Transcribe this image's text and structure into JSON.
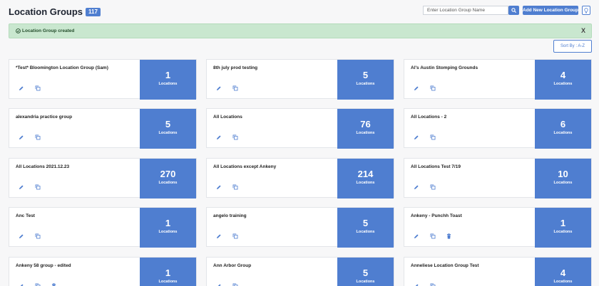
{
  "header": {
    "title": "Location Groups",
    "count_badge": "117",
    "search_placeholder": "Enter Location Group Name",
    "search_icon": "search-icon",
    "add_button_label": "Add New Location Group",
    "tips_icon": "lightbulb-icon"
  },
  "alert": {
    "icon": "check-circle-icon",
    "message": "Location Group created",
    "close_label": "X"
  },
  "sort": {
    "label": "Sort By : A-Z"
  },
  "colors": {
    "accent": "#4f7ed0",
    "alert_bg": "#c9e7cf"
  },
  "card_common": {
    "locations_label": "Locations",
    "icons": [
      "pencil-icon",
      "copy-icon",
      "trash-icon"
    ]
  },
  "cards": [
    {
      "name": "*Test* Bloomington Location Group (Sam)",
      "count": "1",
      "deletable": false
    },
    {
      "name": "8th july prod testing",
      "count": "5",
      "deletable": false
    },
    {
      "name": "Al's Austin Stomping Grounds",
      "count": "4",
      "deletable": false
    },
    {
      "name": "alexandria practice group",
      "count": "5",
      "deletable": false
    },
    {
      "name": "All Locations",
      "count": "76",
      "deletable": false
    },
    {
      "name": "All Locations - 2",
      "count": "6",
      "deletable": false
    },
    {
      "name": "All Locations 2021.12.23",
      "count": "270",
      "deletable": false
    },
    {
      "name": "All Locations except Ankeny",
      "count": "214",
      "deletable": false
    },
    {
      "name": "All Locations Test 7/19",
      "count": "10",
      "deletable": false
    },
    {
      "name": "Anc Test",
      "count": "1",
      "deletable": false
    },
    {
      "name": "angelo training",
      "count": "5",
      "deletable": false
    },
    {
      "name": "Ankeny - Punchh Toast",
      "count": "1",
      "deletable": true
    },
    {
      "name": "Ankeny 58 group - edited",
      "count": "1",
      "deletable": true
    },
    {
      "name": "Ann Arbor Group",
      "count": "5",
      "deletable": false
    },
    {
      "name": "Anneliese Location Group Test",
      "count": "4",
      "deletable": false
    }
  ]
}
